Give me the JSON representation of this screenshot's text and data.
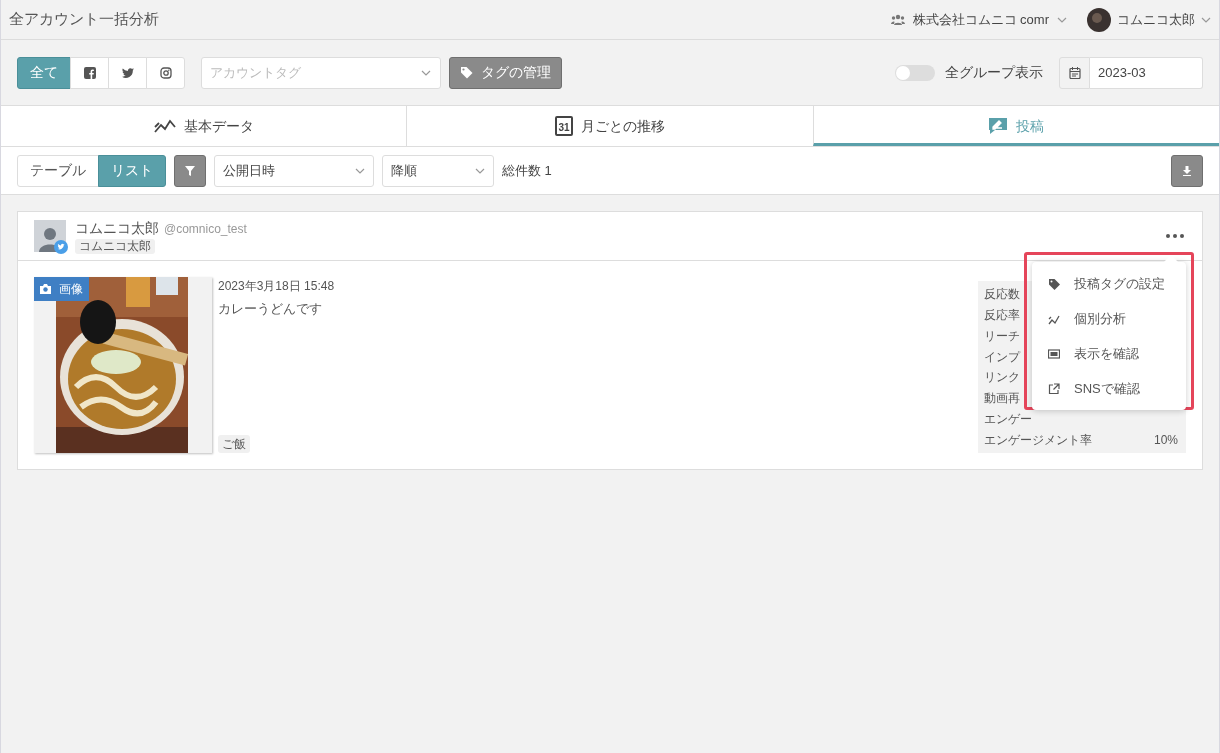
{
  "header": {
    "title": "全アカウント一括分析",
    "company": "株式会社コムニコ comr",
    "user": "コムニコ太郎"
  },
  "sns_filter": [
    {
      "kind": "all",
      "label": "全て",
      "selected": true
    },
    {
      "kind": "facebook",
      "selected": false
    },
    {
      "kind": "twitter",
      "selected": false
    },
    {
      "kind": "instagram",
      "selected": false
    }
  ],
  "account_tag": {
    "placeholder": "アカウントタグ"
  },
  "tag_button": "タグの管理",
  "all_groups": {
    "label": "全グループ表示",
    "on": false
  },
  "month": {
    "value": "2023-03"
  },
  "tabs": [
    {
      "kind": "basic",
      "label": "基本データ",
      "selected": false
    },
    {
      "kind": "monthly",
      "label": "月ごとの推移",
      "icon_text": "31",
      "selected": false
    },
    {
      "kind": "posts",
      "label": "投稿",
      "selected": true
    }
  ],
  "view": [
    {
      "label": "テーブル",
      "selected": false
    },
    {
      "label": "リスト",
      "selected": true
    }
  ],
  "sort_field": "公開日時",
  "sort_order": "降順",
  "total": "総件数 1",
  "post": {
    "account_name": "コムニコ太郎",
    "handle": "@comnico_test",
    "account_tag": "コムニコ太郎",
    "media_label": "画像",
    "date": "2023年3月18日 15:48",
    "text": "カレーうどんです",
    "tag": "ご飯",
    "metrics": [
      {
        "label": "反応数"
      },
      {
        "label": "反応率"
      },
      {
        "label": "リーチ"
      },
      {
        "label": "インプ"
      },
      {
        "label": "リンク"
      },
      {
        "label": "動画再"
      },
      {
        "label": "エンゲー"
      },
      {
        "label": "エンゲージメント率",
        "value": "10%"
      }
    ]
  },
  "menu": [
    {
      "kind": "tag",
      "label": "投稿タグの設定"
    },
    {
      "kind": "chart",
      "label": "個別分析"
    },
    {
      "kind": "screen",
      "label": "表示を確認"
    },
    {
      "kind": "external",
      "label": "SNSで確認"
    }
  ]
}
